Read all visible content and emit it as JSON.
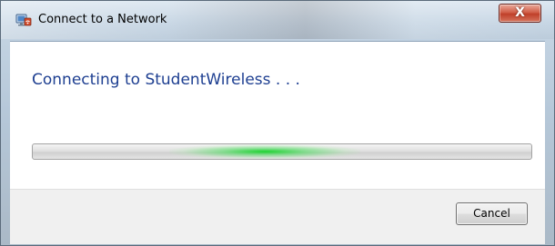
{
  "window": {
    "title": "Connect to a Network",
    "close_label": "X"
  },
  "content": {
    "status_text": "Connecting to StudentWireless . . ."
  },
  "progress": {
    "state": "indeterminate",
    "accent": "#2bd13b"
  },
  "footer": {
    "cancel_label": "Cancel"
  }
}
